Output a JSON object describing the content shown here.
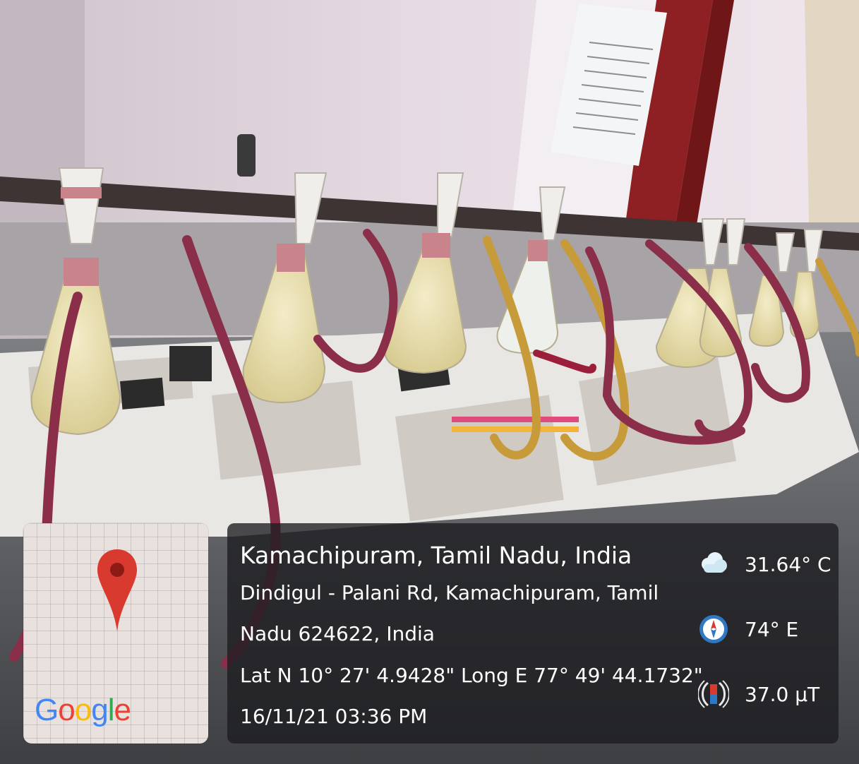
{
  "location": {
    "title": "Kamachipuram, Tamil Nadu, India",
    "address_line1": "Dindigul - Palani Rd, Kamachipuram, Tamil",
    "address_line2": "Nadu 624622, India",
    "coordinates": "Lat N 10° 27' 4.9428\" Long E 77° 49' 44.1732\"",
    "datetime": "16/11/21 03:36 PM"
  },
  "readings": {
    "temperature": "31.64° C",
    "direction": "74° E",
    "magnetic_field": "37.0 μT"
  },
  "map": {
    "brand": "Google",
    "pin_icon": "map-pin-icon",
    "pin_color": "#d93a2f"
  },
  "icons": {
    "weather": "cloud-icon",
    "compass": "compass-icon",
    "magnet": "magnet-icon"
  }
}
